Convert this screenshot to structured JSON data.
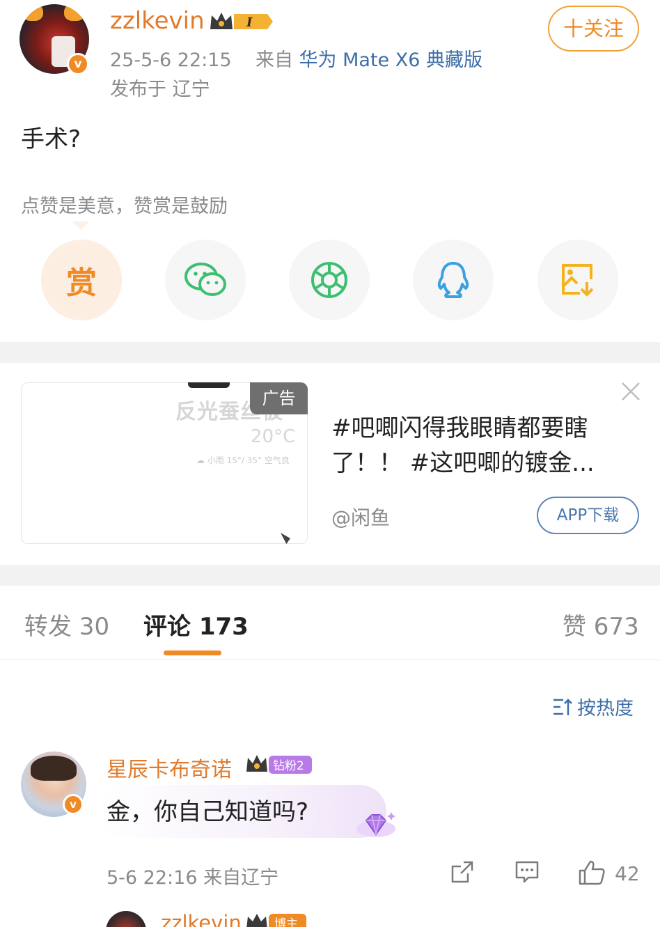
{
  "post": {
    "username": "zzlkevin",
    "level_badge": "I",
    "datetime": "25-5-6 22:15",
    "source_prefix": "来自",
    "device": "华为 Mate X6 典藏版",
    "location": "发布于 辽宁",
    "follow_label": "十关注",
    "text": "手术?",
    "tip": "点赞是美意，赞赏是鼓励",
    "reward_label": "赏"
  },
  "share_icons": [
    "reward-icon",
    "wechat-icon",
    "moments-icon",
    "qq-icon",
    "save-image-icon"
  ],
  "ad": {
    "tag": "广告",
    "image_overlay_title": "反光蚕丝被",
    "image_overlay_temp": "20°C",
    "image_overlay_small": "☁ 小雨  15°/ 35°  空气良",
    "title": "#吧唧闪得我眼睛都要瞎了！！ #这吧唧的镀金...",
    "source": "@闲鱼",
    "button": "APP下载"
  },
  "tabs": {
    "repost": "转发 30",
    "comment": "评论 173",
    "like": "赞 673"
  },
  "sort_label": "按热度",
  "comment": {
    "name": "星辰卡布奇诺",
    "badge": "钻粉2",
    "text": "金，你自己知道吗?",
    "meta": "5-6 22:16 来自辽宁",
    "like_count": "42"
  },
  "reply": {
    "name": "zzlkevin",
    "badge": "博主"
  },
  "colors": {
    "accent_orange": "#f08a24",
    "link_blue": "#3d6ea8",
    "separator": "#f2f2f2"
  }
}
